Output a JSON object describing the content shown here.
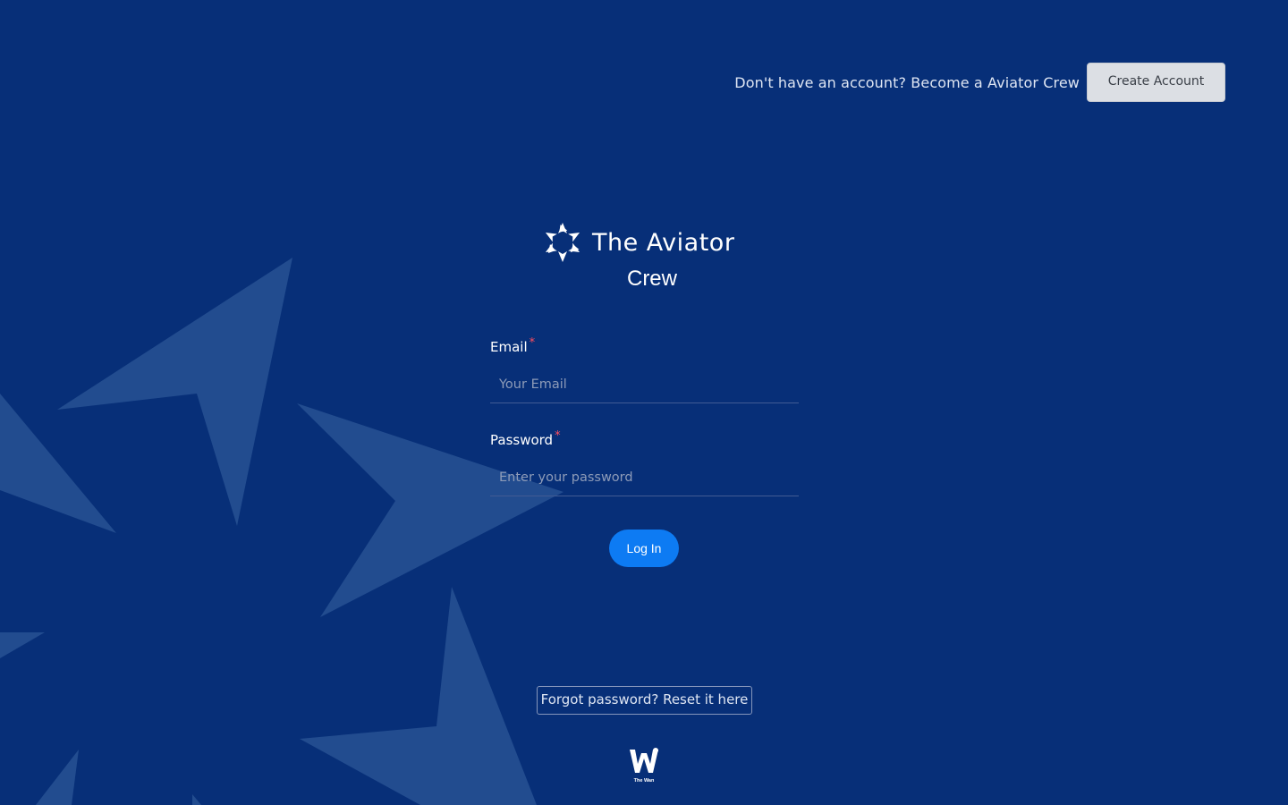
{
  "header": {
    "prompt_text": "Don't have an account? Become a Aviator Crew",
    "create_account_label": "Create Account"
  },
  "brand": {
    "logo_text": "The Aviator",
    "subtitle": "Crew"
  },
  "form": {
    "email": {
      "label": "Email",
      "required_mark": "*",
      "value": "",
      "placeholder": "Your Email"
    },
    "password": {
      "label": "Password",
      "required_mark": "*",
      "value": "",
      "placeholder": "Enter your password"
    },
    "login_label": "Log In"
  },
  "forgot": {
    "label": "Forgot password? Reset it here"
  },
  "footer": {
    "logo_caption": "The Wan"
  },
  "colors": {
    "background": "#072f78",
    "primary_button": "#0d7bf3",
    "required": "#ff4d5e",
    "decor_shape": "#2a5596"
  }
}
